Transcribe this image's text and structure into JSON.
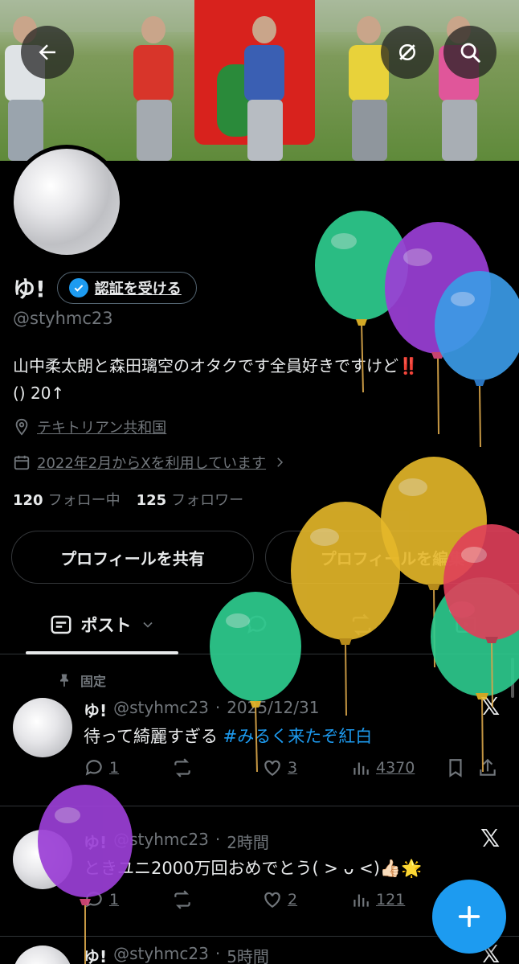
{
  "header": {
    "back_icon": "arrow-left-icon",
    "grok_icon": "grok-icon",
    "search_icon": "search-icon"
  },
  "profile": {
    "name": "ゆ!",
    "verify_label": "認証を受ける",
    "handle": "@styhmc23",
    "bio_line1": "山中柔太朗と森田璃空のオタクです全員好きですけど‼️",
    "bio_line2": "() 20↑",
    "location": "テキトリアン共和国",
    "joined": "2022年2月からXを利用しています",
    "following_count": "120",
    "following_label": "フォロー中",
    "followers_count": "125",
    "followers_label": "フォロワー",
    "share_button": "プロフィールを共有",
    "edit_button": "プロフィールを編集"
  },
  "tabs": [
    {
      "label": "ポスト",
      "icon": "posts-icon",
      "active": true
    },
    {
      "label": "",
      "icon": "reply-icon"
    },
    {
      "label": "",
      "icon": "repost-icon"
    },
    {
      "label": "",
      "icon": "media-icon"
    }
  ],
  "posts": [
    {
      "pinned_label": "固定",
      "name": "ゆ!",
      "handle": "@styhmc23",
      "time": "2025/12/31",
      "text": "待って綺麗すぎる ",
      "hashtag": "#みるく来たぞ紅白",
      "replies": "1",
      "reposts": "",
      "likes": "3",
      "views": "4370"
    },
    {
      "name": "ゆ!",
      "handle": "@styhmc23",
      "time": "2時間",
      "text": "ときユニ2000万回おめでとう( > ᴗ <)👍🏻🌟",
      "replies": "1",
      "reposts": "",
      "likes": "2",
      "views": "121"
    },
    {
      "name": "ゆ!",
      "handle": "@styhmc23",
      "time": "5時間"
    }
  ],
  "colors": {
    "accent": "#1d9bf0",
    "background": "#000000",
    "secondary_text": "#71767b",
    "balloon_green": "#2ecc8f",
    "balloon_purple": "#9b3fd6",
    "balloon_blue": "#3b9be6",
    "balloon_yellow": "#e6b82a",
    "balloon_red": "#e0405a"
  }
}
